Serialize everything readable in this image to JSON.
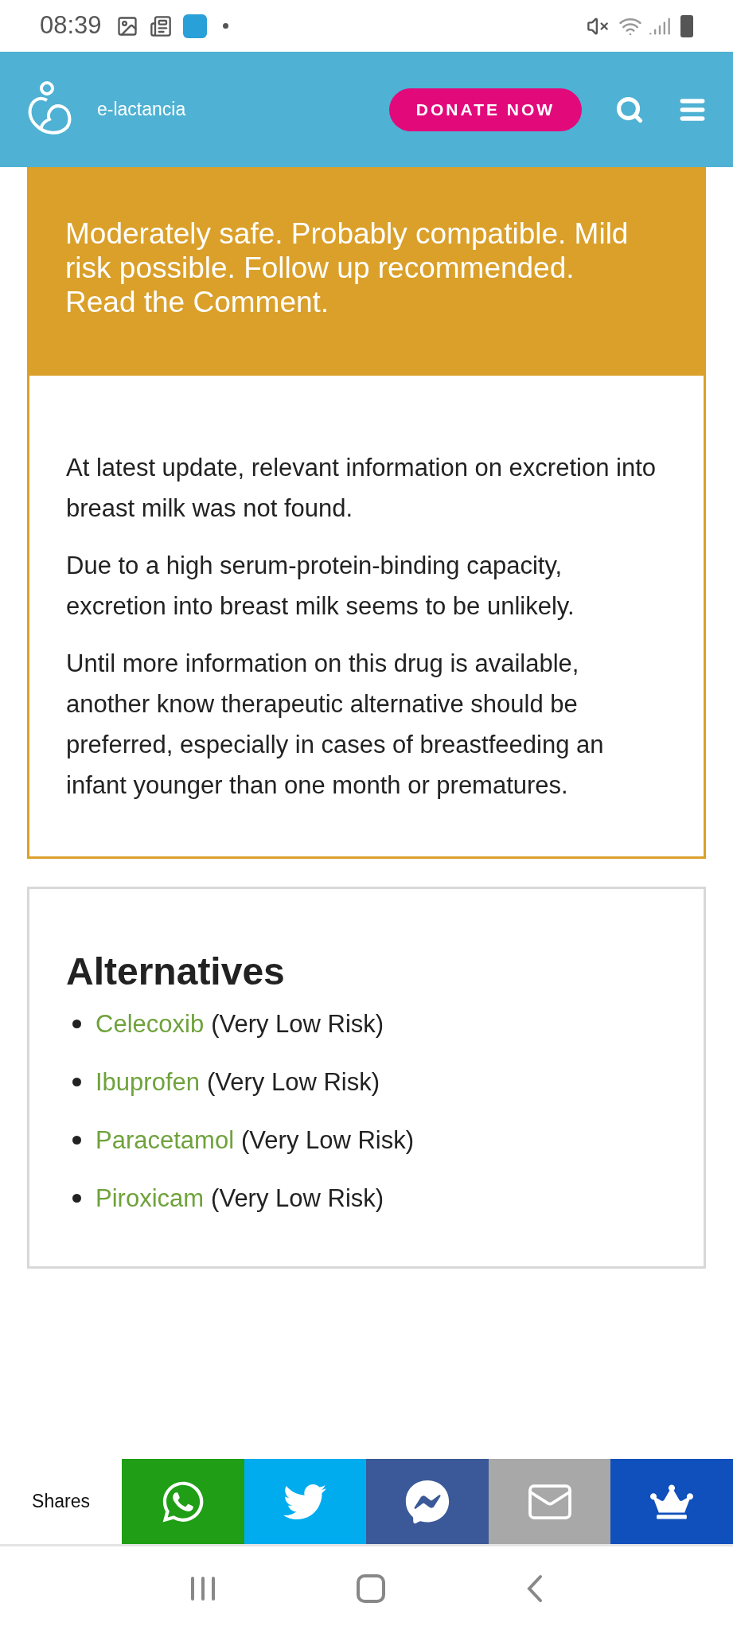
{
  "status_bar": {
    "time": "08:39"
  },
  "header": {
    "site_name": "e-lactancia",
    "donate_button": "DONATE NOW"
  },
  "risk_box": {
    "paragraphs": [
      "Moderately safe. Probably compatible. Mild risk possible. Follow up recommended.",
      "Read the Comment."
    ]
  },
  "comment": {
    "paragraphs": [
      "At latest update, relevant information on excretion into breast milk was not found.",
      "Due to a high serum-protein-binding capacity, excretion into breast milk seems to be unlikely.",
      "Until more information on this drug is available, another know therapeutic alternative should be preferred, especially in cases of breastfeeding an infant younger than one month or prematures."
    ]
  },
  "alternatives": {
    "title": "Alternatives",
    "items": [
      {
        "name": "Celecoxib",
        "risk": "(Very Low Risk)"
      },
      {
        "name": "Ibuprofen",
        "risk": "(Very Low Risk)"
      },
      {
        "name": "Paracetamol",
        "risk": "(Very Low Risk)"
      },
      {
        "name": "Piroxicam",
        "risk": "(Very Low Risk)"
      }
    ]
  },
  "share_bar": {
    "label": "Shares",
    "buttons": [
      {
        "kind": "whatsapp"
      },
      {
        "kind": "twitter"
      },
      {
        "kind": "messenger"
      },
      {
        "kind": "email"
      },
      {
        "kind": "crown"
      }
    ]
  }
}
